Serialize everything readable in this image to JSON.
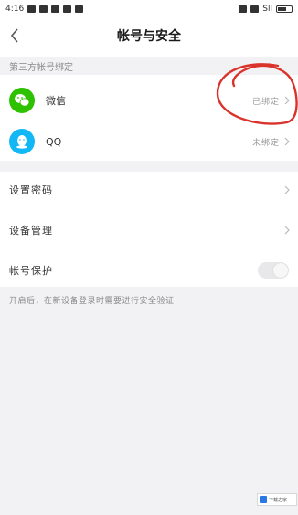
{
  "status_bar": {
    "time": "4:16",
    "signal_text": "Sll"
  },
  "header": {
    "title": "帐号与安全"
  },
  "third_party": {
    "section_label": "第三方帐号绑定",
    "items": [
      {
        "label": "微信",
        "value": "已绑定",
        "icon": "wechat-icon",
        "color": "#2dc100"
      },
      {
        "label": "QQ",
        "value": "未绑定",
        "icon": "qq-icon",
        "color": "#12b7f5"
      }
    ]
  },
  "settings": {
    "items": [
      {
        "label": "设置密码"
      },
      {
        "label": "设备管理"
      },
      {
        "label": "帐号保护"
      }
    ]
  },
  "note": {
    "text": "开启后，在新设备登录时需要进行安全验证"
  },
  "watermark": {
    "text": "下载之家"
  },
  "colors": {
    "annotation": "#d9332b",
    "background_band": "#f2f2f4"
  }
}
